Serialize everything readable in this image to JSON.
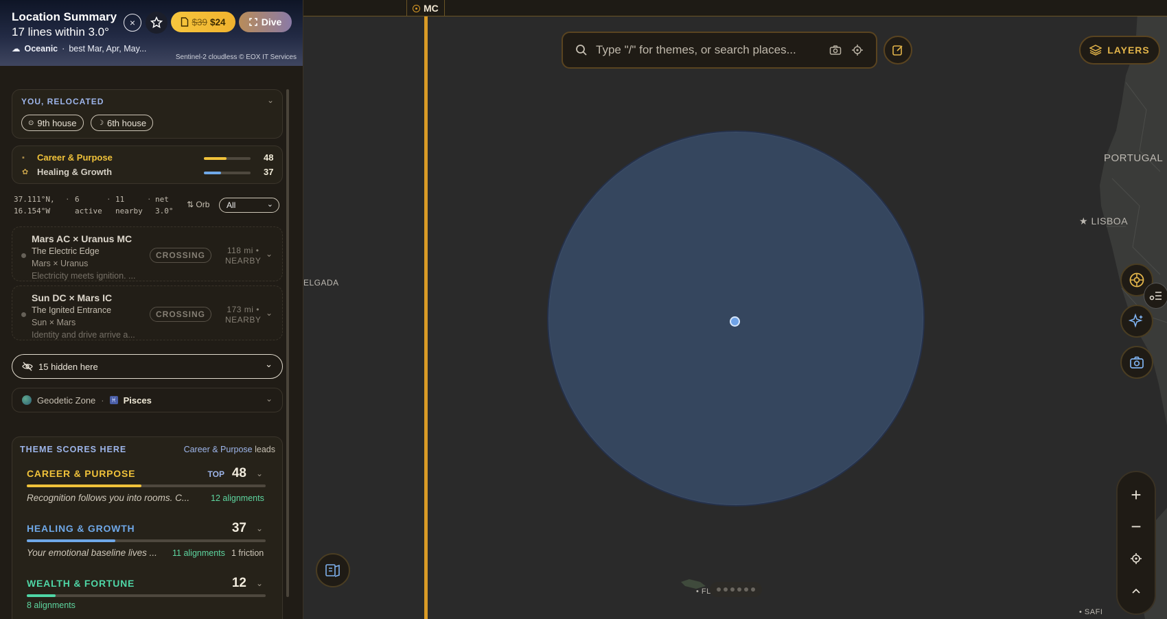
{
  "header": {
    "title": "Location Summary",
    "subtitle": "17 lines within 3.0°",
    "climate": "Oceanic",
    "best_season": "best Mar, Apr, May...",
    "credit": "Sentinel-2 cloudless © EOX IT Services",
    "price_old": "$39",
    "price_new": "$24",
    "dive_label": "Dive"
  },
  "relocated": {
    "heading": "YOU, RELOCATED",
    "pills": [
      "9th house",
      "6th house"
    ]
  },
  "themes_summary": [
    {
      "label": "Career & Purpose",
      "score": "48",
      "fill": 0.48,
      "color": "#f0c23a"
    },
    {
      "label": "Healing & Growth",
      "score": "37",
      "fill": 0.37,
      "color": "#6fa8e8"
    }
  ],
  "stats": {
    "coords_lat": "37.111°N,",
    "coords_lon": "16.154°W",
    "active_count": "6",
    "active_label": "active",
    "nearby_count": "11",
    "nearby_label": "nearby",
    "net_label": "net",
    "net_value": "3.0°",
    "orb_label": "Orb",
    "filter_value": "All"
  },
  "lines": [
    {
      "title": "Mars AC × Uranus MC",
      "subtitle": "The Electric Edge",
      "pair": "Mars × Uranus",
      "desc": "Electricity meets ignition. ...",
      "badge": "CROSSING",
      "distance": "118 mi •",
      "distance_label": "NEARBY"
    },
    {
      "title": "Sun DC × Mars IC",
      "subtitle": "The Ignited Entrance",
      "pair": "Sun × Mars",
      "desc": "Identity and drive arrive a...",
      "badge": "CROSSING",
      "distance": "173 mi •",
      "distance_label": "NEARBY"
    }
  ],
  "hidden": {
    "label": "15 hidden here"
  },
  "zone": {
    "label": "Geodetic Zone",
    "sign": "Pisces"
  },
  "scores": {
    "heading": "THEME SCORES HERE",
    "lead_theme": "Career & Purpose",
    "lead_suffix": "leads",
    "items": [
      {
        "name": "CAREER & PURPOSE",
        "score": "48",
        "badge": "TOP",
        "fill": 0.48,
        "color": "#f0c23a",
        "desc": "Recognition follows you into rooms. C...",
        "alignments": "12 alignments",
        "friction": ""
      },
      {
        "name": "HEALING & GROWTH",
        "score": "37",
        "badge": "",
        "fill": 0.37,
        "color": "#6fa8e8",
        "desc": "Your emotional baseline lives ...",
        "alignments": "11 alignments",
        "friction": "1 friction"
      },
      {
        "name": "WEALTH & FORTUNE",
        "score": "12",
        "badge": "",
        "fill": 0.12,
        "color": "#4fd6a6",
        "desc": "",
        "alignments": "8 alignments",
        "friction": ""
      }
    ]
  },
  "map": {
    "mc_label": "MC",
    "search_placeholder": "Type \"/\" for themes, or search places...",
    "layers_label": "LAYERS",
    "labels": {
      "portugal": "PORTUGAL",
      "lisboa": "LISBOA",
      "delgada": "ELGADA",
      "safi": "SAFI",
      "funchal": "FL"
    }
  }
}
